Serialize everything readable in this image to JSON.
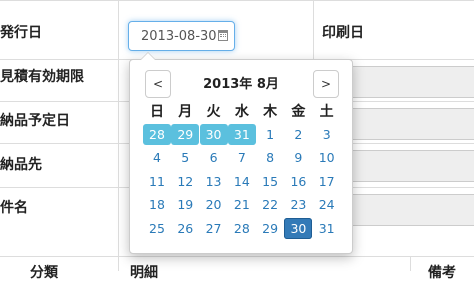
{
  "form": {
    "labels": {
      "issue_date": "発行日",
      "quote_expiry": "見積有効期限",
      "delivery_date": "納品予定日",
      "delivery_to": "納品先",
      "subject": "件名",
      "print_date": "印刷日"
    },
    "bottom_headers": {
      "category": "分類",
      "detail": "明細",
      "note": "備考"
    },
    "date_input_value": "2013-08-30"
  },
  "datepicker": {
    "title": "2013年 8月",
    "prev_label": "<",
    "next_label": ">",
    "weekdays": [
      "日",
      "月",
      "火",
      "水",
      "木",
      "金",
      "土"
    ],
    "weeks": [
      [
        "28",
        "29",
        "30",
        "31",
        "1",
        "2",
        "3"
      ],
      [
        "4",
        "5",
        "6",
        "7",
        "8",
        "9",
        "10"
      ],
      [
        "11",
        "12",
        "13",
        "14",
        "15",
        "16",
        "17"
      ],
      [
        "18",
        "19",
        "20",
        "21",
        "22",
        "23",
        "24"
      ],
      [
        "25",
        "26",
        "27",
        "28",
        "29",
        "30",
        "31"
      ]
    ],
    "colors": {
      "prev_month_day": "#5bc0de",
      "selected_day": "#337ab7",
      "day_text": "#2a7ab8"
    }
  }
}
